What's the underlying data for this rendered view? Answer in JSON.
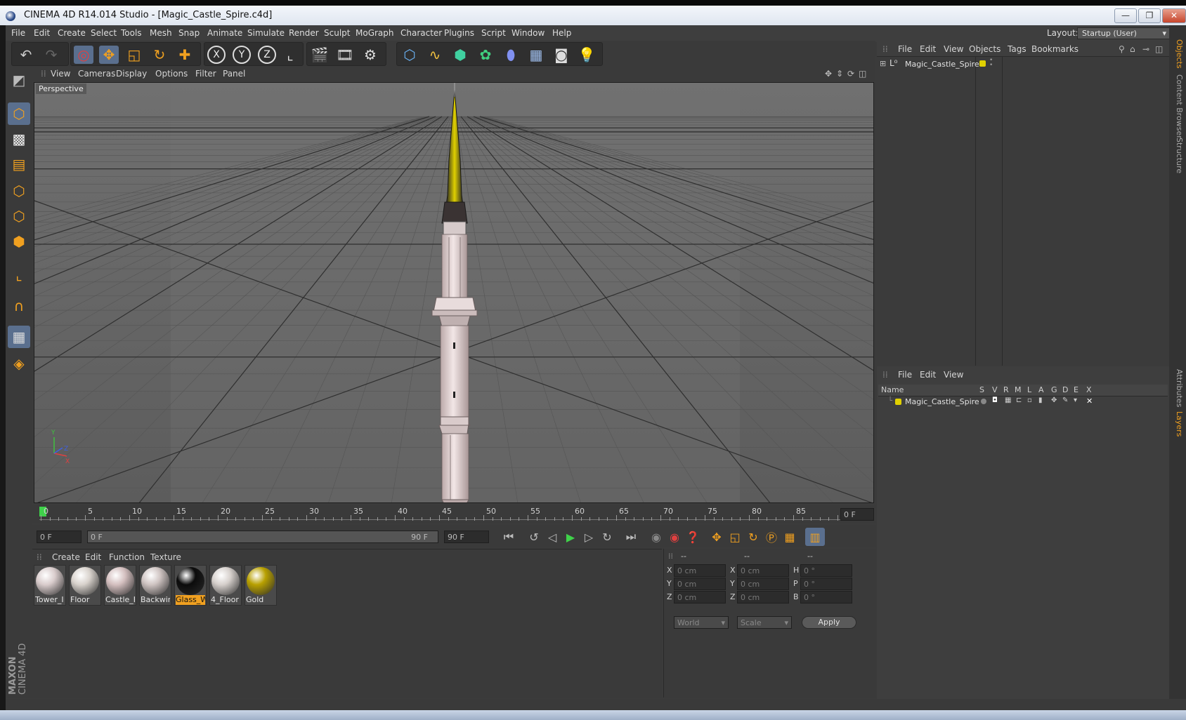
{
  "window": {
    "title": "CINEMA 4D R14.014 Studio - [Magic_Castle_Spire.c4d]",
    "buttons": [
      "—",
      "❐",
      "✕"
    ]
  },
  "menubar": {
    "items": [
      "File",
      "Edit",
      "Create",
      "Select",
      "Tools",
      "Mesh",
      "Snap",
      "Animate",
      "Simulate",
      "Render",
      "Sculpt",
      "MoGraph",
      "Character",
      "Plugins",
      "Script",
      "Window",
      "Help"
    ],
    "layout_label": "Layout:",
    "layout_value": "Startup (User)"
  },
  "toolbar": {
    "icons": [
      "undo-icon",
      "redo-icon",
      "live-selection-icon",
      "move-icon",
      "scale-icon",
      "rotate-icon",
      "add-icon",
      "x-axis-icon",
      "y-axis-icon",
      "z-axis-icon",
      "coordinate-system-icon",
      "render-view-icon",
      "render-picture-viewer-icon",
      "render-settings-icon",
      "cube-icon",
      "spline-icon",
      "nurbs-icon",
      "array-icon",
      "deformer-icon",
      "floor-icon",
      "camera-icon",
      "light-icon"
    ],
    "axis_labels": [
      "X",
      "Y",
      "Z"
    ]
  },
  "viewport": {
    "menu": [
      "View",
      "Cameras",
      "Display",
      "Options",
      "Filter",
      "Panel"
    ],
    "label": "Perspective",
    "axis_labels": [
      "Y",
      "X",
      "Z"
    ]
  },
  "timeline": {
    "ticks": [
      "0",
      "5",
      "10",
      "15",
      "20",
      "25",
      "30",
      "35",
      "40",
      "45",
      "50",
      "55",
      "60",
      "65",
      "70",
      "75",
      "80",
      "85",
      "90"
    ],
    "current_frame": "0 F"
  },
  "transport": {
    "start": "0 F",
    "range_start": "0 F",
    "range_end": "90 F",
    "end": "90 F"
  },
  "materials": {
    "menu": [
      "Create",
      "Edit",
      "Function",
      "Texture"
    ],
    "items": [
      {
        "label": "Tower_I",
        "color": "#d9cccc"
      },
      {
        "label": "Floor",
        "color": "#d8d2cc"
      },
      {
        "label": "Castle_H",
        "color": "#d4bfbf"
      },
      {
        "label": "Backwin",
        "color": "#cfc4c2"
      },
      {
        "label": "Glass_W",
        "color": "#0b0b0b",
        "selected": true
      },
      {
        "label": "4_Floor",
        "color": "#d6d0cc"
      },
      {
        "label": "Gold",
        "color": "#b8a000"
      }
    ]
  },
  "coords": {
    "headers": [
      "--",
      "--",
      "--"
    ],
    "rows": [
      {
        "l1": "X",
        "v1": "0 cm",
        "l2": "X",
        "v2": "0 cm",
        "l3": "H",
        "v3": "0 °"
      },
      {
        "l1": "Y",
        "v1": "0 cm",
        "l2": "Y",
        "v2": "0 cm",
        "l3": "P",
        "v3": "0 °"
      },
      {
        "l1": "Z",
        "v1": "0 cm",
        "l2": "Z",
        "v2": "0 cm",
        "l3": "B",
        "v3": "0 °"
      }
    ],
    "world": "World",
    "scale": "Scale",
    "apply": "Apply"
  },
  "objects": {
    "menu": [
      "File",
      "Edit",
      "View",
      "Objects",
      "Tags",
      "Bookmarks"
    ],
    "tree": [
      {
        "name": "Magic_Castle_Spire"
      }
    ]
  },
  "layers": {
    "menu": [
      "File",
      "Edit",
      "View"
    ],
    "columns": [
      "Name",
      "S",
      "V",
      "R",
      "M",
      "L",
      "A",
      "G",
      "D",
      "E",
      "X"
    ],
    "rows": [
      {
        "name": "Magic_Castle_Spire"
      }
    ]
  },
  "side_tabs": [
    "Objects",
    "Content Browser",
    "Structure",
    "Attributes",
    "Layers"
  ],
  "branding": {
    "maxon": "MAXON",
    "cinema": "CINEMA 4D"
  },
  "colors": {
    "accent": "#f0a020",
    "selection": "#5a6f8e",
    "layer_yellow": "#e0d000"
  }
}
